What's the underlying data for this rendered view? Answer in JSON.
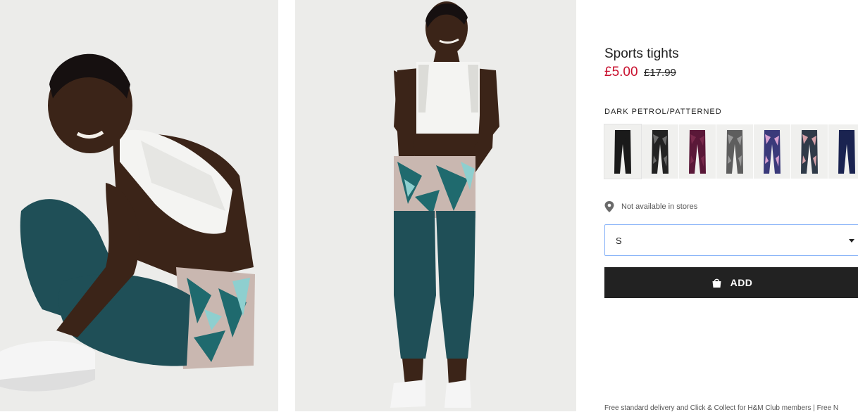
{
  "product": {
    "title": "Sports tights",
    "price_sale": "£5.00",
    "price_original": "£17.99",
    "selected_color": "DARK PETROL/PATTERNED",
    "store_availability": "Not available in stores",
    "size_selected": "S",
    "add_label": "ADD",
    "footer_note": "Free standard delivery and Click & Collect for H&M Club members | Free N"
  },
  "swatches": [
    {
      "color": "#1a1a1a",
      "accent": "#1a1a1a"
    },
    {
      "color": "#222222",
      "accent": "#6b6b6b"
    },
    {
      "color": "#5a1838",
      "accent": "#7a2a4c"
    },
    {
      "color": "#5e5e5e",
      "accent": "#9a9a9a"
    },
    {
      "color": "#3a3a7a",
      "accent": "#d8a0d0"
    },
    {
      "color": "#2f3a48",
      "accent": "#d5a0a8"
    },
    {
      "color": "#1a2350",
      "accent": "#1a2350"
    }
  ],
  "colors": {
    "sale": "#c8102e",
    "button": "#222222",
    "leggings": "#1f4f57"
  },
  "icons": {
    "store": "location-pin-icon",
    "bag": "shopping-bag-icon",
    "dropdown": "caret-down-icon"
  }
}
